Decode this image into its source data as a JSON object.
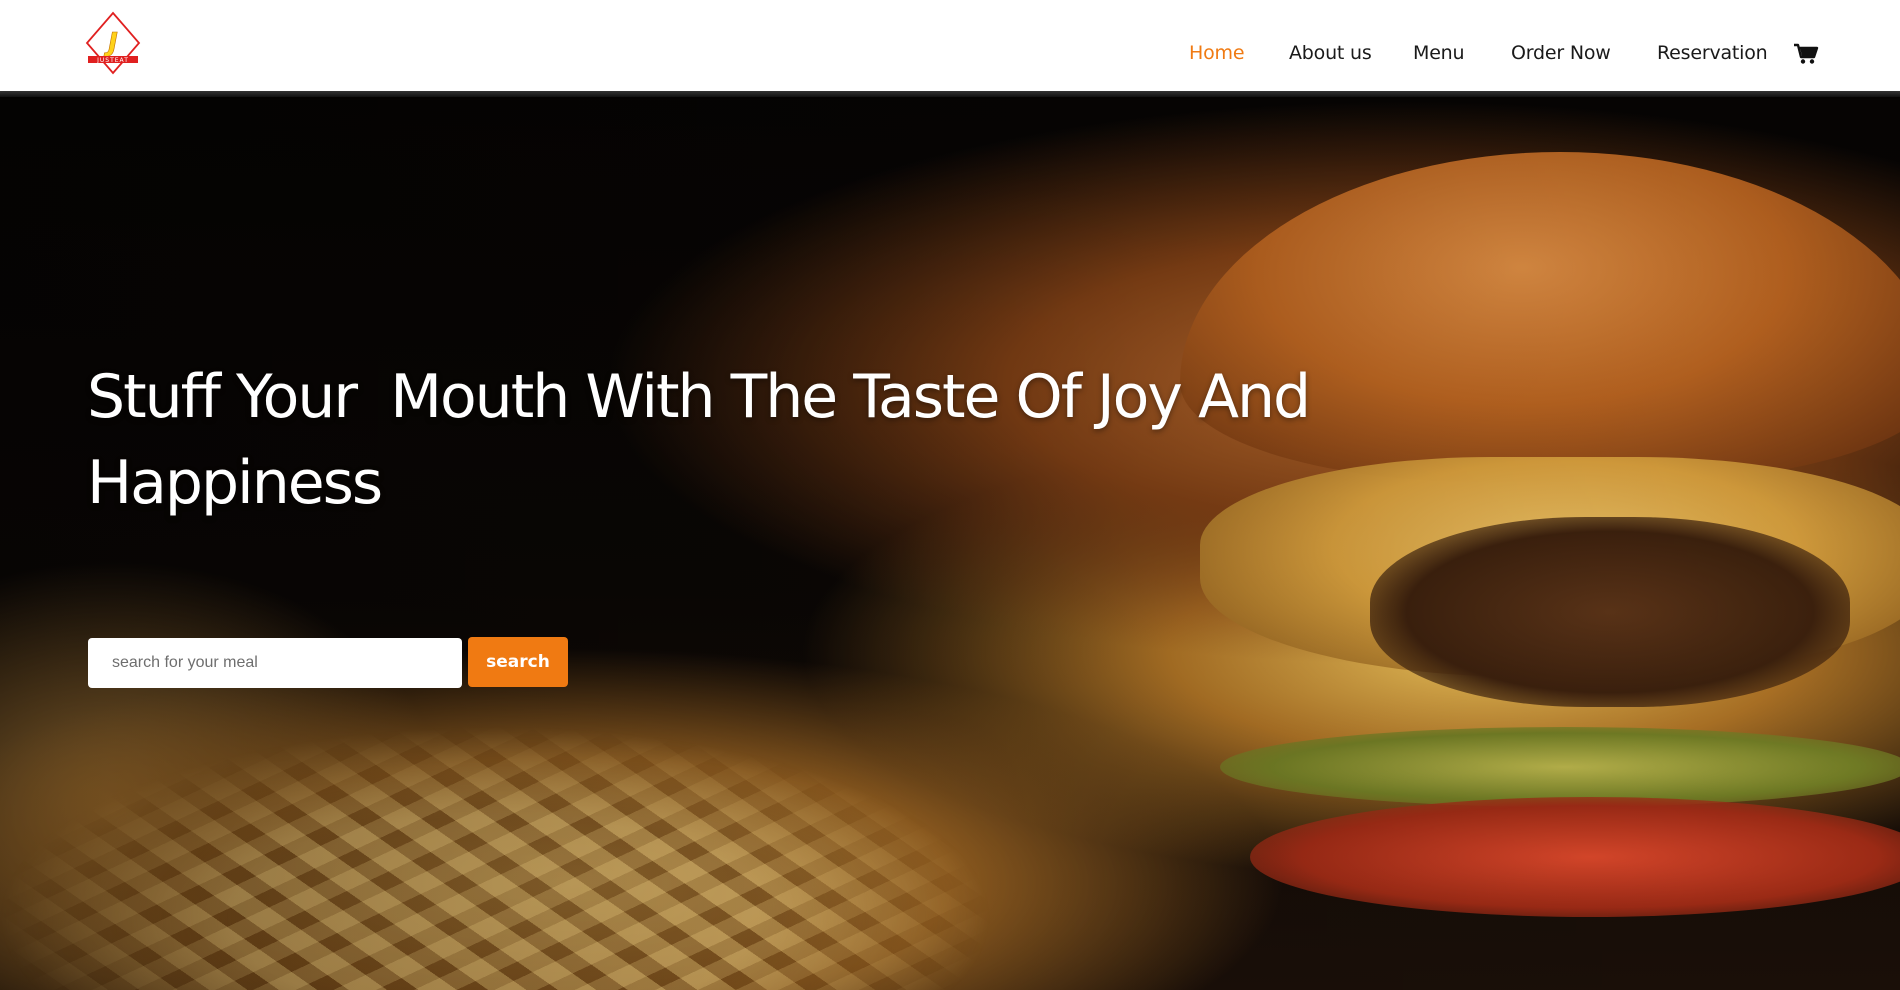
{
  "brand": {
    "logo_letter": "J",
    "logo_text": "JUSTEAT",
    "colors": {
      "accent": "#f07a12",
      "logo_red": "#e02020",
      "logo_yellow": "#ffd21a"
    }
  },
  "nav": {
    "items": [
      {
        "label": "Home",
        "active": true
      },
      {
        "label": "About us",
        "active": false
      },
      {
        "label": "Menu",
        "active": false
      },
      {
        "label": "Order Now",
        "active": false
      },
      {
        "label": "Reservation",
        "active": false
      }
    ],
    "cart_icon": "cart-icon"
  },
  "hero": {
    "headline": "Stuff Your  Mouth With The Taste Of Joy And Happiness",
    "search": {
      "placeholder": "search for your meal",
      "value": "",
      "button_label": "search"
    }
  }
}
